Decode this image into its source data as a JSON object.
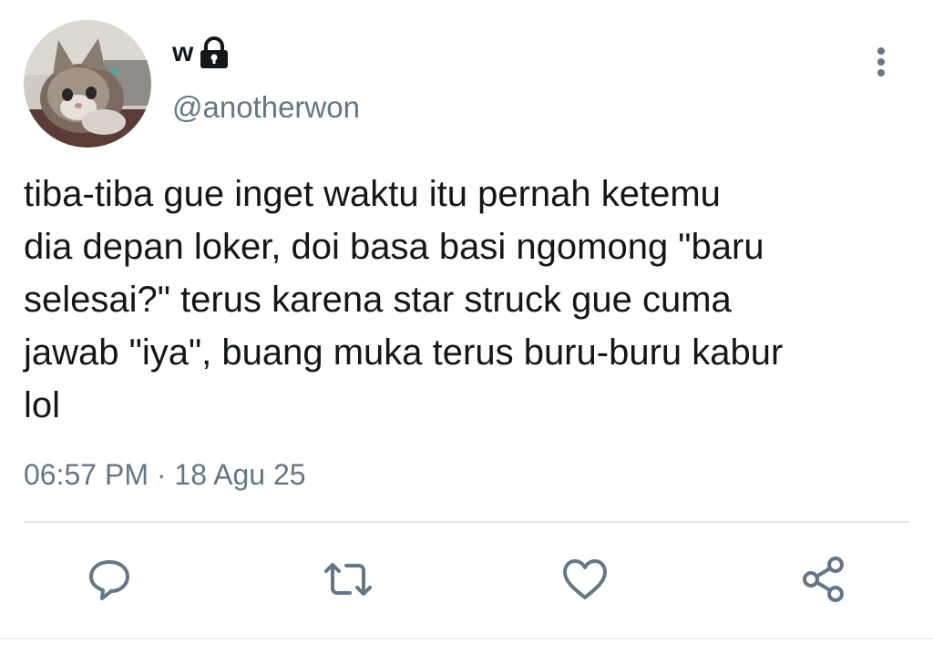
{
  "tweet": {
    "display_name": "w",
    "username": "@anotherwon",
    "text_lines": [
      "tiba-tiba gue inget waktu itu pernah ketemu",
      "dia depan loker, doi basa basi ngomong \"baru",
      "selesai?\" terus karena star struck gue cuma",
      "jawab \"iya\", buang muka terus buru-buru kabur",
      "lol"
    ],
    "time": "06:57 PM",
    "separator": "·",
    "date": "18 Agu 25"
  },
  "icons": {
    "protected": "lock-icon",
    "more": "more-vertical-icon",
    "reply": "reply-icon",
    "retweet": "retweet-icon",
    "like": "heart-icon",
    "share": "share-icon"
  },
  "colors": {
    "text": "#14171a",
    "secondary": "#657786",
    "divider": "#e1e8ed"
  }
}
